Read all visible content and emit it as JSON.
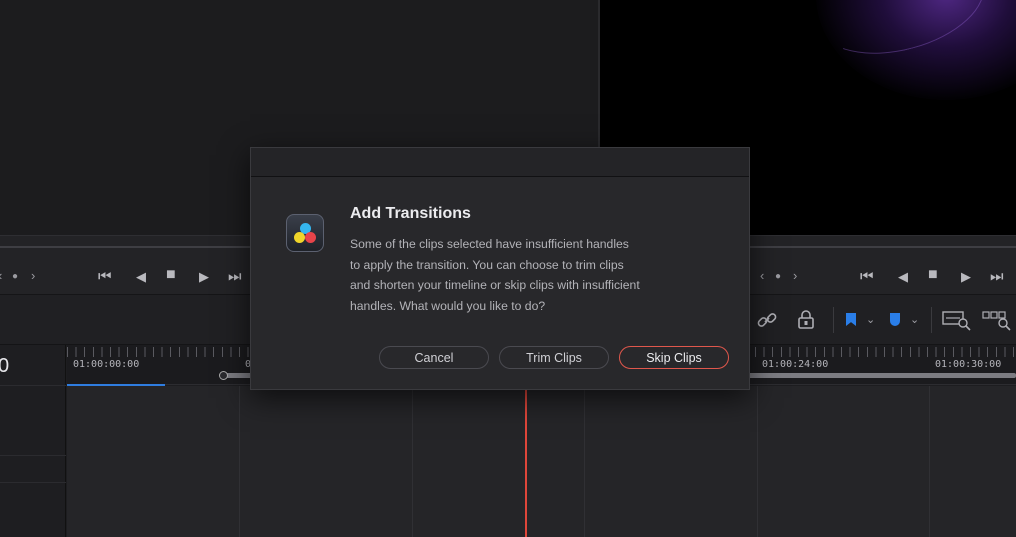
{
  "viewer": {
    "left_transport": {
      "prev_icon": "‹",
      "dot_icon": "●",
      "next_icon": "›"
    },
    "right_transport": {
      "prev_icon": "‹",
      "dot_icon": "●",
      "next_icon": "›"
    },
    "controls": {
      "first": "⏮",
      "prev": "◀",
      "stop": "■",
      "play": "▶",
      "last": "⏭"
    }
  },
  "toolbar": {
    "icons": [
      "link-icon",
      "lock-icon",
      "blue-flag-icon",
      "chevron-down-icon",
      "blue-marker-icon",
      "chevron-down-icon",
      "zoom-fit-icon",
      "zoom-detail-icon"
    ]
  },
  "timeline": {
    "timecode_left": "0",
    "ruler_labels": [
      "01:00:00:00",
      "0",
      "01:00:24:00",
      "01:00:30:00"
    ],
    "accent_color": "#2f7de0",
    "playhead_color": "#e0463a"
  },
  "dialog": {
    "title": "Add Transitions",
    "message_lines": [
      "Some of the clips selected have insufficient handles",
      "to apply the transition. You can choose to trim clips",
      "and shorten your timeline or skip clips with insufficient",
      "handles. What would you like to do?"
    ],
    "buttons": {
      "cancel": "Cancel",
      "trim": "Trim Clips",
      "skip": "Skip Clips"
    },
    "primary_color": "#e0574c"
  }
}
